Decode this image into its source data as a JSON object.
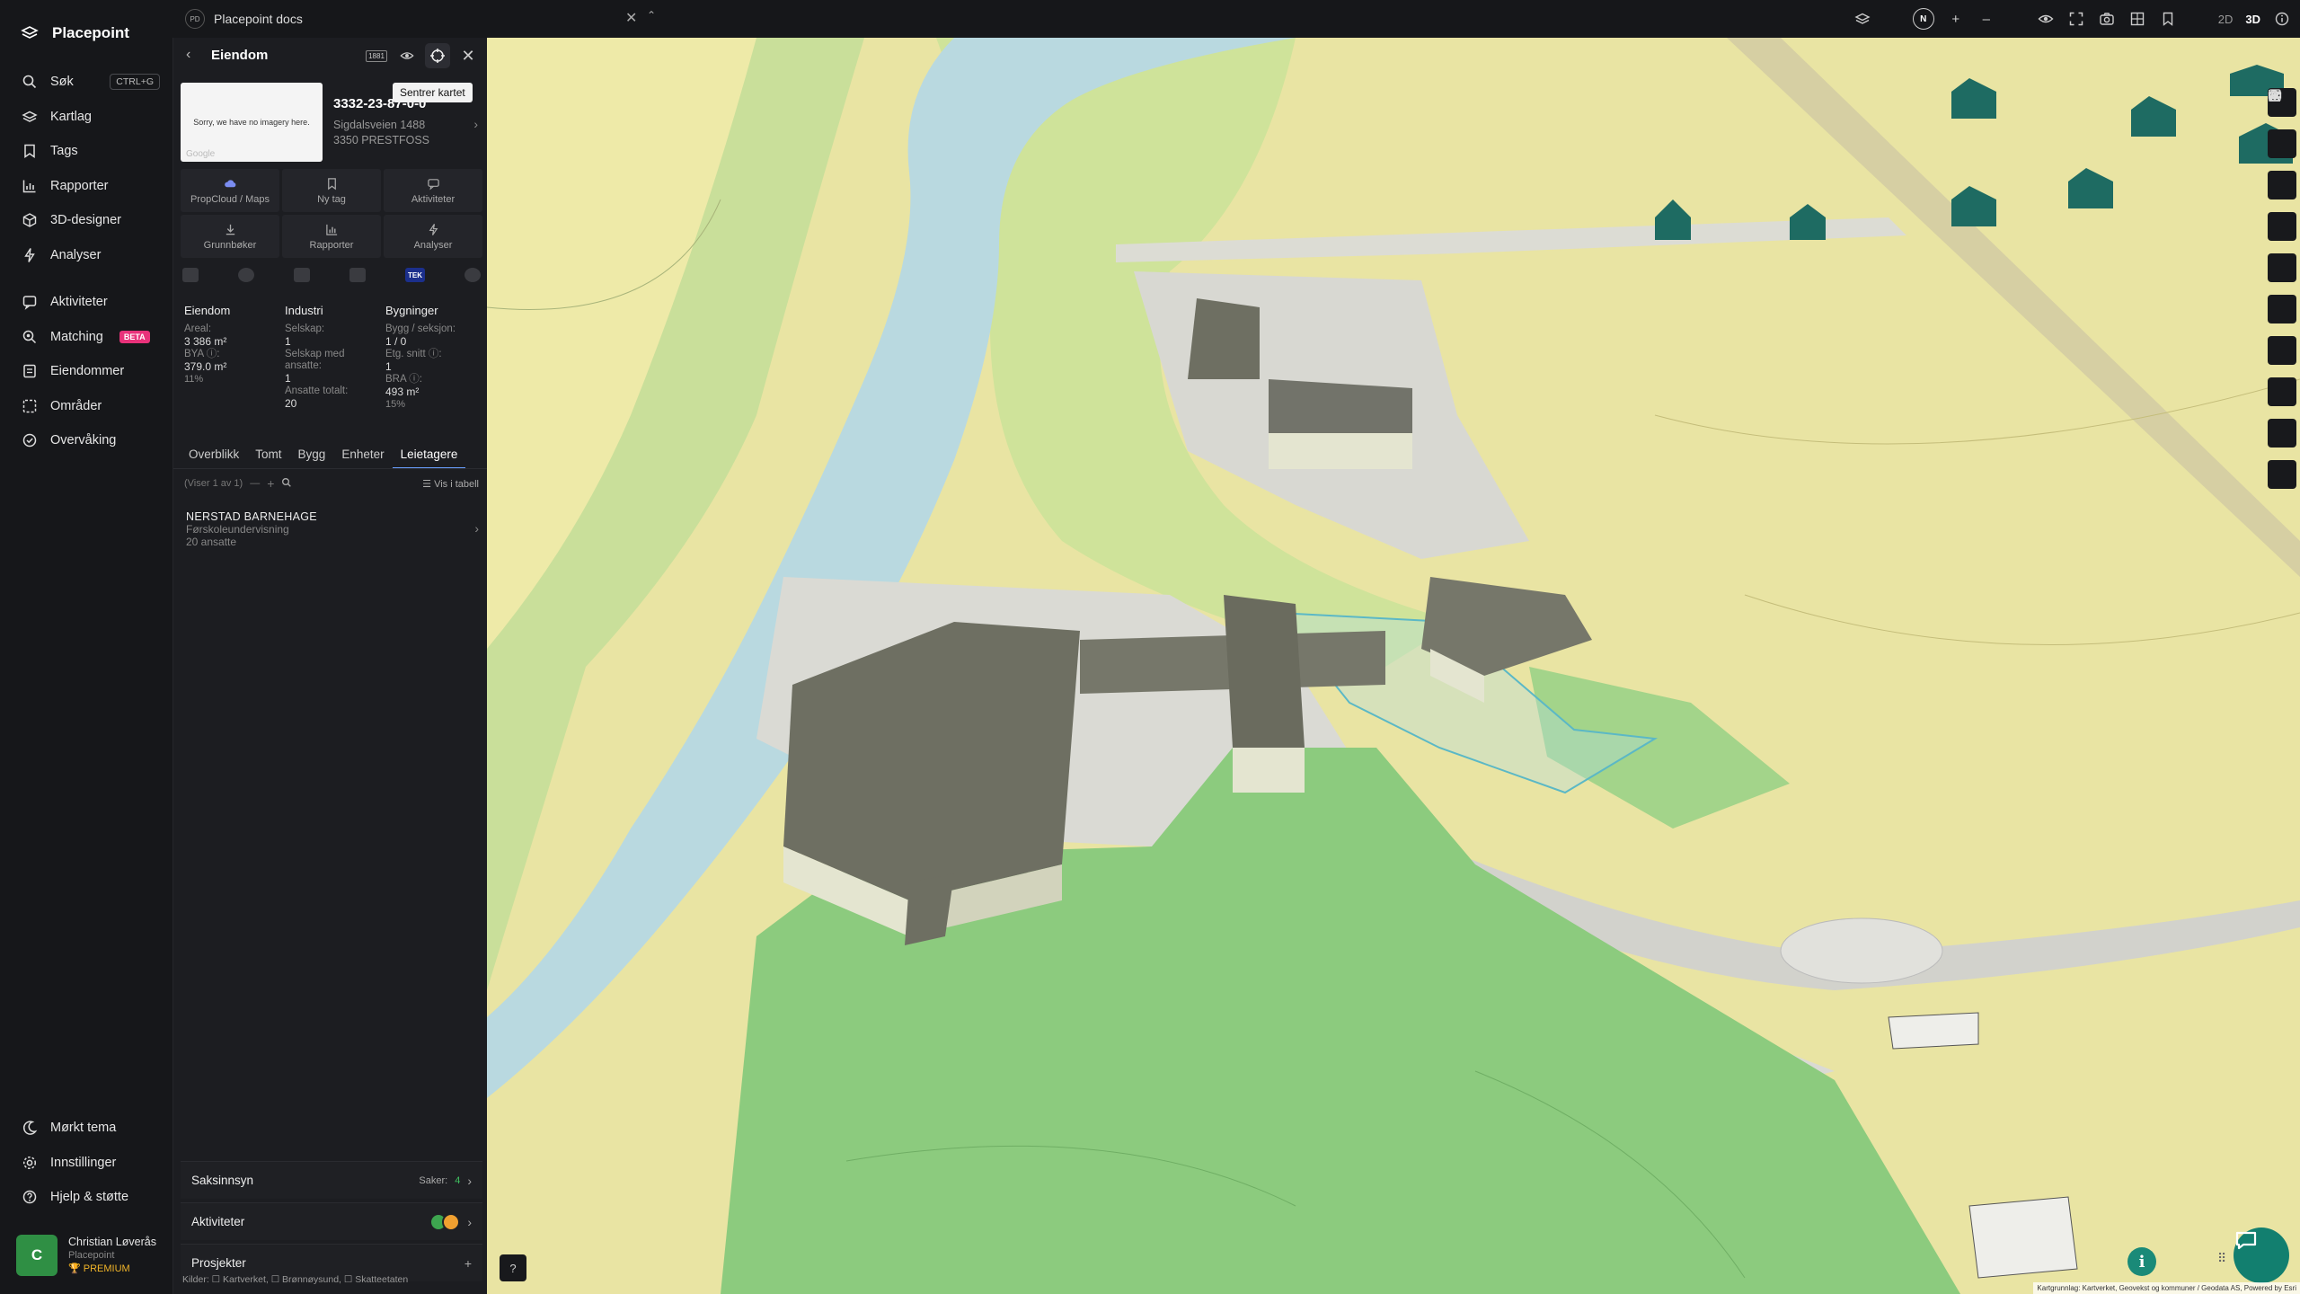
{
  "app": {
    "brand": "Placepoint",
    "search_shortcut": "CTRL+G"
  },
  "nav": {
    "items": [
      {
        "label": "Søk",
        "icon": "search-icon"
      },
      {
        "label": "Kartlag",
        "icon": "layers-icon"
      },
      {
        "label": "Tags",
        "icon": "bookmark-icon"
      },
      {
        "label": "Rapporter",
        "icon": "chart-icon"
      },
      {
        "label": "3D-designer",
        "icon": "cube-icon"
      },
      {
        "label": "Analyser",
        "icon": "bolt-icon"
      },
      {
        "label": "Aktiviteter",
        "icon": "activity-icon"
      },
      {
        "label": "Matching",
        "icon": "match-icon",
        "badge": "BETA"
      },
      {
        "label": "Eiendommer",
        "icon": "building-icon"
      },
      {
        "label": "Områder",
        "icon": "area-icon"
      },
      {
        "label": "Overvåking",
        "icon": "monitor-icon"
      }
    ],
    "bottom": [
      {
        "label": "Mørkt tema",
        "icon": "moon-icon"
      },
      {
        "label": "Innstillinger",
        "icon": "gear-icon"
      },
      {
        "label": "Hjelp & støtte",
        "icon": "help-icon"
      }
    ],
    "user": {
      "initial": "C",
      "name": "Christian Løverås",
      "org": "Placepoint",
      "plan": "PREMIUM"
    }
  },
  "topbar": {
    "doc_badge": "PD",
    "doc_title": "Placepoint docs",
    "compass": "N",
    "mode_2d": "2D",
    "mode_3d": "3D"
  },
  "panel": {
    "title": "Eiendom",
    "badge": "1881",
    "tooltip": "Sentrer kartet",
    "thumb_text": "Sorry, we have no imagery here.",
    "thumb_brand": "Google",
    "property_id": "3332-23-87-0-0",
    "address_line1": "Sigdalsveien 1488",
    "address_line2": "3350 PRESTFOSS",
    "tiles": [
      {
        "label": "PropCloud / Maps",
        "icon": "cloud-icon"
      },
      {
        "label": "Ny tag",
        "icon": "tag-icon"
      },
      {
        "label": "Aktiviteter",
        "icon": "chat-icon"
      },
      {
        "label": "Grunnbøker",
        "icon": "download-icon"
      },
      {
        "label": "Rapporter",
        "icon": "chart-icon"
      },
      {
        "label": "Analyser",
        "icon": "bolt-icon"
      }
    ],
    "source_badge": "TEK",
    "stats": {
      "eiendom": {
        "head": "Eiendom",
        "areal_label": "Areal:",
        "areal_value": "3 386 m²",
        "bya_label": "BYA ⓘ:",
        "bya_value": "379.0 m²",
        "bya_pct": "11%"
      },
      "industri": {
        "head": "Industri",
        "selskap_label": "Selskap:",
        "selskap_value": "1",
        "ansatte_label": "Selskap med ansatte:",
        "ansatte_value": "1",
        "totalt_label": "Ansatte totalt:",
        "totalt_value": "20"
      },
      "bygninger": {
        "head": "Bygninger",
        "bygg_label": "Bygg / seksjon:",
        "bygg_value": "1 / 0",
        "etg_label": "Etg. snitt ⓘ:",
        "etg_value": "1",
        "bra_label": "BRA ⓘ:",
        "bra_value": "493 m²",
        "bra_pct": "15%"
      }
    },
    "tabs": [
      "Overblikk",
      "Tomt",
      "Bygg",
      "Enheter",
      "Leietagere"
    ],
    "active_tab": "Leietagere",
    "toolbar_count": "(Viser 1 av 1)",
    "table_view": "Vis i tabell",
    "tenant": {
      "name": "NERSTAD BARNEHAGE",
      "type": "Førskoleundervisning",
      "employees": "20 ansatte"
    },
    "sections": {
      "saksinnsyn": "Saksinnsyn",
      "saker_label": "Saker:",
      "saker_value": "4",
      "aktiviteter": "Aktiviteter",
      "prosjekter": "Prosjekter"
    },
    "sources": "Kilder: ☐ Kartverket, ☐ Brønnøysund, ☐ Skatteetaten"
  },
  "map": {
    "attribution": "Kartgrunnlag: Kartverket, Geovekst og kommuner / Geodata AS, Powered by Esri",
    "colors": {
      "water": "#b9d9e0",
      "field_yellow": "#f1eca8",
      "forest_green": "#8ccb7e",
      "building": "#6e6f62",
      "teal_house": "#1e6b62"
    }
  }
}
